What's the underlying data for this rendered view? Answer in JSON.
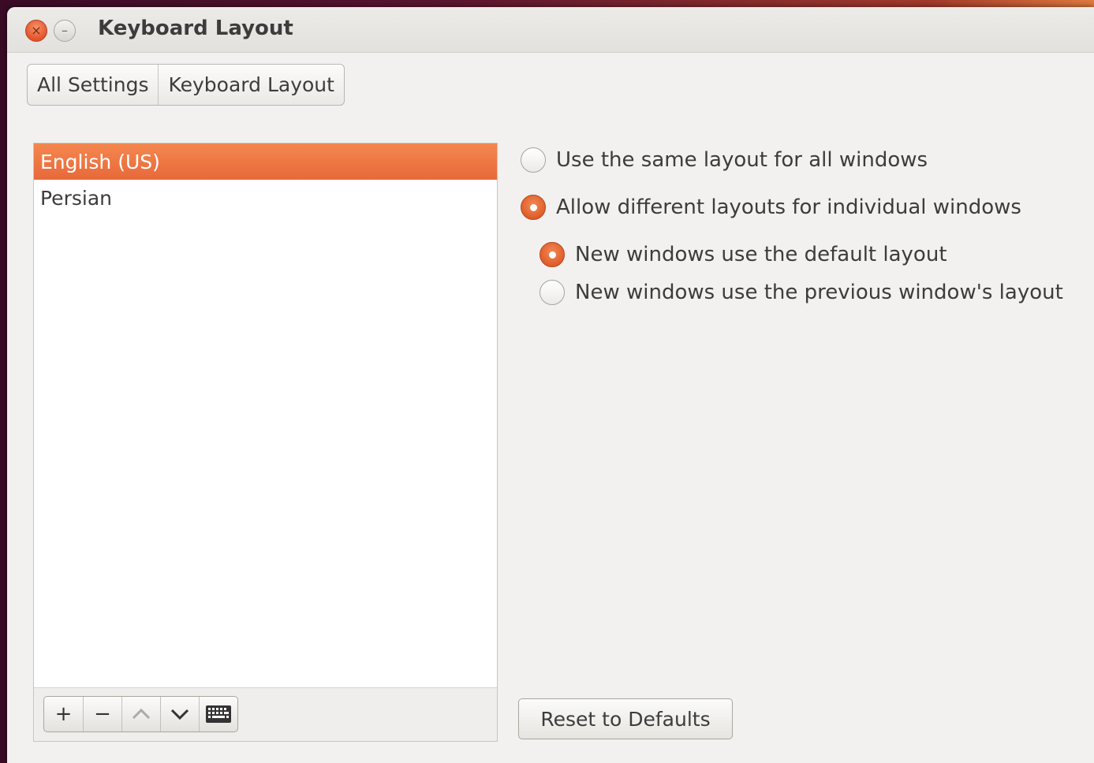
{
  "window": {
    "title": "Keyboard Layout",
    "close_glyph": "×",
    "minimize_glyph": "–"
  },
  "breadcrumb": {
    "items": [
      "All Settings",
      "Keyboard Layout"
    ]
  },
  "layouts": {
    "items": [
      "English (US)",
      "Persian"
    ],
    "selected": "English (US)"
  },
  "toolbar": {
    "add_glyph": "+",
    "remove_glyph": "−",
    "up_glyph": "︿",
    "down_glyph": "﹀",
    "keyboard_icon": "keyboard-icon"
  },
  "options": {
    "same_layout": "Use the same layout for all windows",
    "different_layouts": "Allow different layouts for individual windows",
    "default_layout": "New windows use the default layout",
    "previous_layout": "New windows use the previous window's layout"
  },
  "reset_label": "Reset to Defaults",
  "colors": {
    "accent": "#e8693a",
    "window_bg": "#f2f1f0"
  }
}
